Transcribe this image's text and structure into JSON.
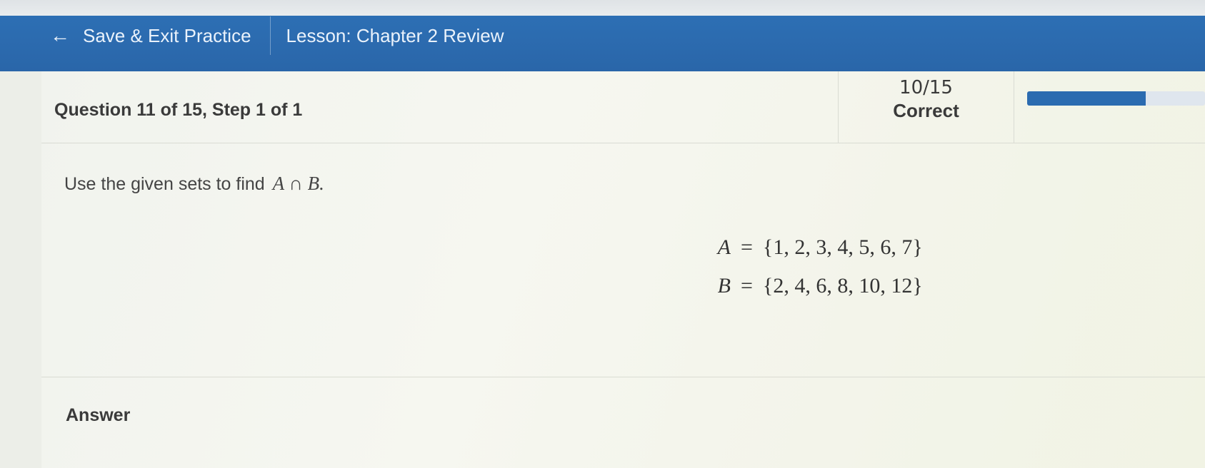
{
  "topbar": {
    "back_icon": "left-arrow-icon",
    "back_glyph": "←",
    "save_exit_label": "Save & Exit Practice",
    "lesson_title": "Lesson: Chapter 2 Review"
  },
  "question_header": {
    "title": "Question 11 of 15, Step 1 of 1",
    "score_count": "10/15",
    "score_label": "Correct",
    "progress_fraction": 0.6667,
    "accent_color": "#2b6bb0"
  },
  "question": {
    "prompt_text": "Use the given sets to find",
    "prompt_math": "A ∩ B.",
    "sets": [
      {
        "name": "A",
        "elements": "{1, 2, 3, 4, 5, 6, 7}"
      },
      {
        "name": "B",
        "elements": "{2, 4, 6, 8, 10, 12}"
      }
    ],
    "equals": "="
  },
  "answer": {
    "label": "Answer"
  }
}
